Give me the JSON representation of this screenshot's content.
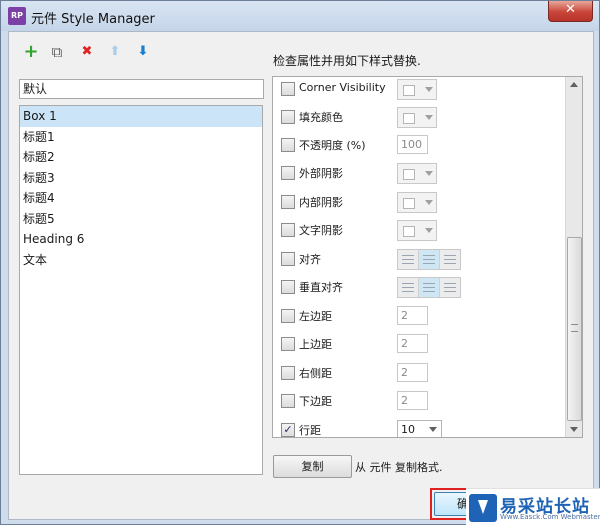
{
  "window": {
    "title": "元件 Style Manager",
    "close_symbol": "✕"
  },
  "toolbar": {
    "add": "+",
    "duplicate": "⧉",
    "delete": "✖",
    "move_up": "⬆",
    "move_down": "⬇",
    "colors": {
      "add": "#2fa52f",
      "delete": "#e02424",
      "move_up_disabled": "#a9cdeb",
      "move_down": "#1a7fd0"
    }
  },
  "style_name": "默认",
  "styles": [
    "Box 1",
    "标题1",
    "标题2",
    "标题3",
    "标题4",
    "标题5",
    "Heading 6",
    "文本"
  ],
  "selected_style": "Box 1",
  "properties_title": "检查属性并用如下样式替换.",
  "properties": [
    {
      "label": "Corner Visibility",
      "checked": false,
      "control": "swatch"
    },
    {
      "label": "填充颜色",
      "checked": false,
      "control": "swatch"
    },
    {
      "label": "不透明度 (%)",
      "checked": false,
      "control": "number",
      "value": "100"
    },
    {
      "label": "外部阴影",
      "checked": false,
      "control": "swatch"
    },
    {
      "label": "内部阴影",
      "checked": false,
      "control": "swatch"
    },
    {
      "label": "文字阴影",
      "checked": false,
      "control": "swatch"
    },
    {
      "label": "对齐",
      "checked": false,
      "control": "align"
    },
    {
      "label": "垂直对齐",
      "checked": false,
      "control": "align"
    },
    {
      "label": "左边距",
      "checked": false,
      "control": "number",
      "value": "2"
    },
    {
      "label": "上边距",
      "checked": false,
      "control": "number",
      "value": "2"
    },
    {
      "label": "右侧距",
      "checked": false,
      "control": "number",
      "value": "2"
    },
    {
      "label": "下边距",
      "checked": false,
      "control": "number",
      "value": "2"
    },
    {
      "label": "行距",
      "checked": true,
      "control": "dropdown",
      "value": "10"
    }
  ],
  "copy_button": "复制",
  "copy_text": "从 元件 复制格式.",
  "ok_button": "确",
  "watermark": {
    "text": "易采站长站",
    "sub": "Www.Easck.Com  Webmaster"
  },
  "highlight_color": "#e02020"
}
